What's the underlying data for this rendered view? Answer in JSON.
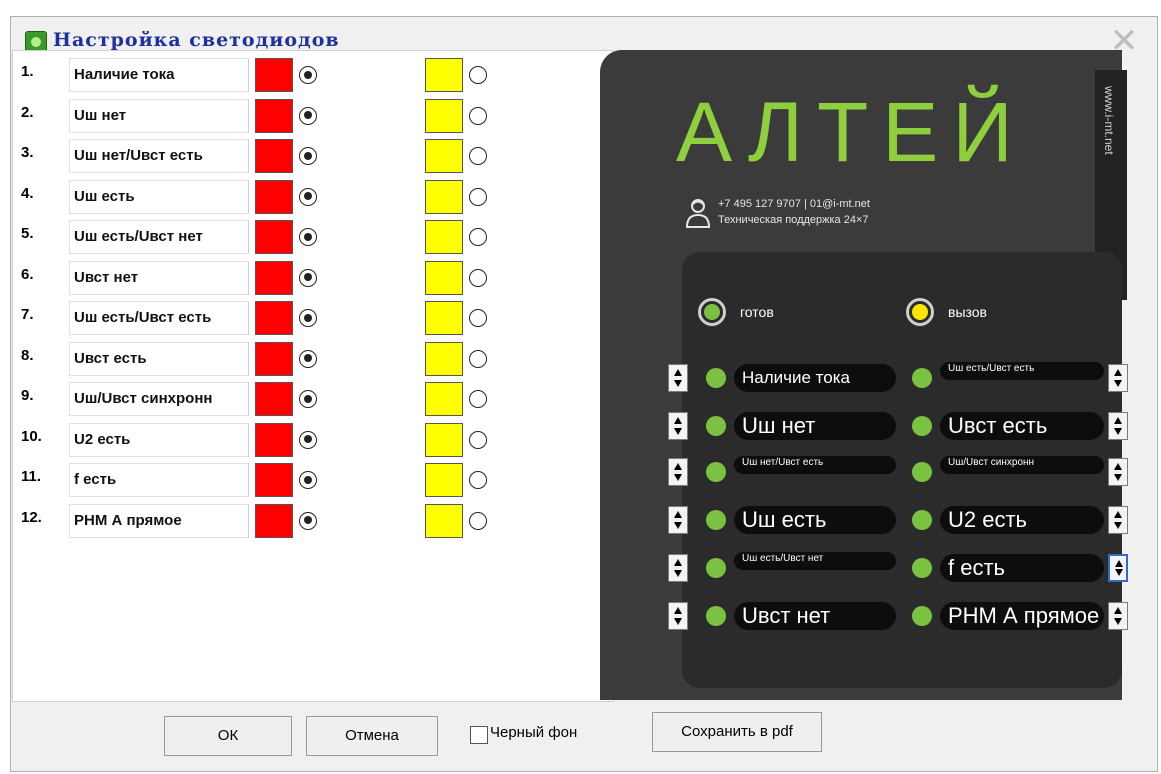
{
  "window": {
    "title": "Настройка светодиодов"
  },
  "rows": [
    {
      "num": "1.",
      "label": "Наличие тока"
    },
    {
      "num": "2.",
      "label": "Uш нет"
    },
    {
      "num": "3.",
      "label": "Uш нет/Uвст есть"
    },
    {
      "num": "4.",
      "label": "Uш есть"
    },
    {
      "num": "5.",
      "label": "Uш есть/Uвст нет"
    },
    {
      "num": "6.",
      "label": "Uвст нет"
    },
    {
      "num": "7.",
      "label": "Uш есть/Uвст есть"
    },
    {
      "num": "8.",
      "label": "Uвст есть"
    },
    {
      "num": "9.",
      "label": "Uш/Uвст синхронн"
    },
    {
      "num": "10.",
      "label": "U2 есть"
    },
    {
      "num": "11.",
      "label": "f есть"
    },
    {
      "num": "12.",
      "label": "РНМ А прямое"
    }
  ],
  "colors": {
    "red": "#ff0000",
    "yellow": "#ffff00",
    "green": "#7cc242",
    "panel": "#3b3b3b"
  },
  "preview": {
    "logo": "АЛТЕЙ",
    "url": "www.i-mt.net",
    "phone": "+7 495 127 9707 | 01@i-mt.net",
    "support": "Техническая поддержка 24×7",
    "ready": "готов",
    "call": "вызов",
    "left": [
      {
        "label": "Наличие тока",
        "size": "med"
      },
      {
        "label": "Uш нет",
        "size": "big"
      },
      {
        "label": "Uш нет/Uвст есть",
        "size": "sm"
      },
      {
        "label": "Uш есть",
        "size": "big"
      },
      {
        "label": "Uш есть/Uвст нет",
        "size": "sm"
      },
      {
        "label": "Uвст нет",
        "size": "big"
      }
    ],
    "right": [
      {
        "label": "Uш есть/Uвст есть",
        "size": "sm"
      },
      {
        "label": "Uвст есть",
        "size": "big"
      },
      {
        "label": "Uш/Uвст синхронн",
        "size": "sm"
      },
      {
        "label": "U2 есть",
        "size": "big"
      },
      {
        "label": "f есть",
        "size": "big"
      },
      {
        "label": "РНМ А прямое",
        "size": "big"
      }
    ]
  },
  "buttons": {
    "ok": "ОК",
    "cancel": "Отмена",
    "black_bg": "Черный фон",
    "save_pdf": "Сохранить в pdf"
  },
  "black_bg_checked": false
}
